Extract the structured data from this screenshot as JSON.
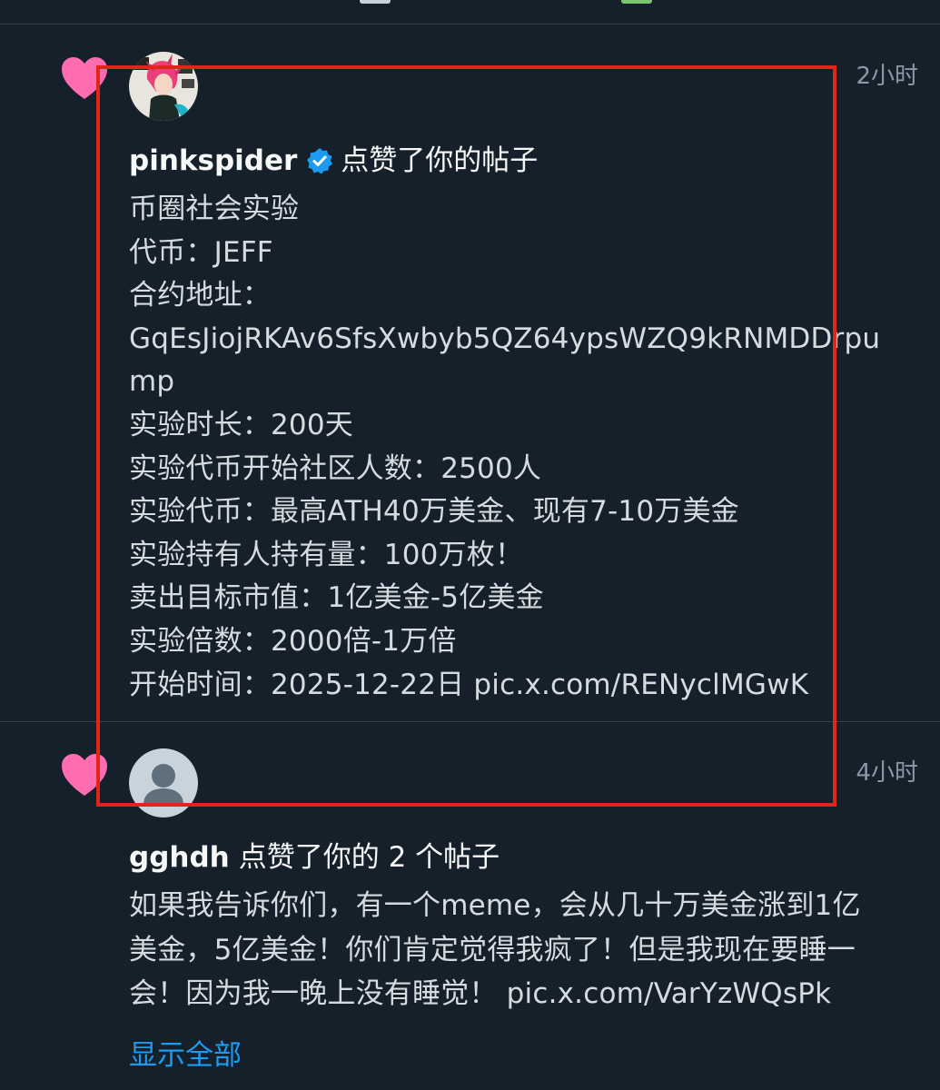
{
  "notifications": [
    {
      "username": "pinkspider",
      "verified": true,
      "action": "点赞了你的帖子",
      "time": "2小时",
      "lines": [
        "币圈社会实验",
        "代币：JEFF",
        "合约地址：",
        "GqEsJiojRKAv6SfsXwbyb5QZ64ypsWZQ9kRNMDDrpump",
        "实验时长：200天",
        "实验代币开始社区人数：2500人",
        "实验代币：最高ATH40万美金、现有7-10万美金",
        "实验持有人持有量：100万枚！",
        "卖出目标市值：1亿美金-5亿美金",
        "实验倍数：2000倍-1万倍",
        "开始时间：2025-12-22日 pic.x.com/RENyclMGwK"
      ]
    },
    {
      "username": "gghdh",
      "verified": false,
      "action": "点赞了你的 2 个帖子",
      "time": "4小时",
      "lines": [
        "如果我告诉你们，有一个meme，会从几十万美金涨到1亿",
        "美金，5亿美金！你们肯定觉得我疯了！但是我现在要睡一",
        "会！因为我一晚上没有睡觉！ pic.x.com/VarYzWQsPk"
      ],
      "show_all": "显示全部"
    }
  ],
  "colors": {
    "background": "#15202b",
    "heart": "#f91880",
    "verified": "#1d9bf0",
    "link": "#1d9bf0",
    "annotation": "#e0261a"
  },
  "icons": {
    "like": "heart-icon",
    "verified": "verified-badge-icon",
    "default_avatar": "default-avatar-icon"
  }
}
